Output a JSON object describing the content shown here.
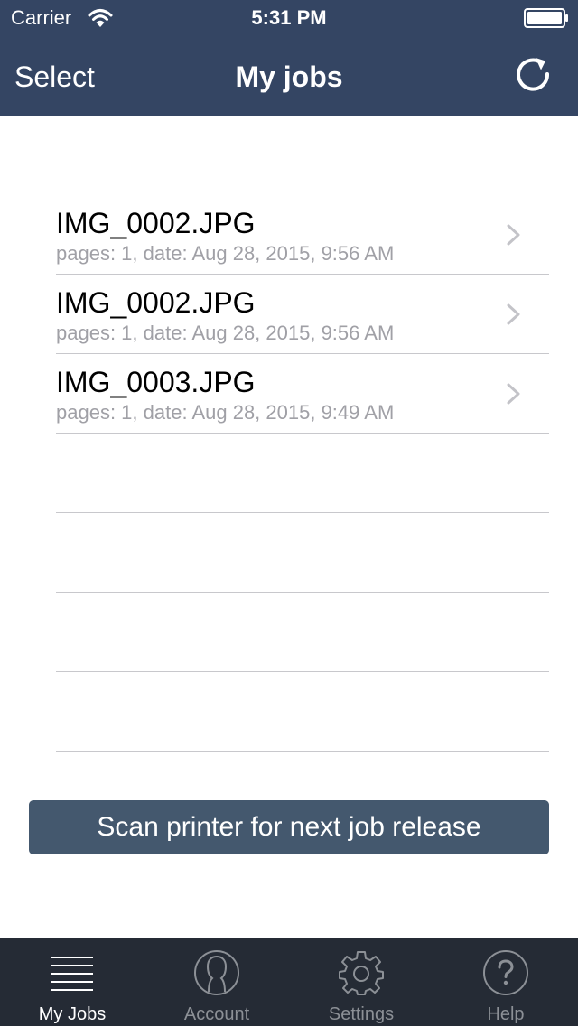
{
  "status_bar": {
    "carrier": "Carrier",
    "time": "5:31 PM"
  },
  "nav": {
    "left_button": "Select",
    "title": "My jobs",
    "right_icon": "refresh-icon"
  },
  "jobs": [
    {
      "name": "IMG_0002.JPG",
      "meta": "pages: 1, date: Aug 28, 2015, 9:56 AM"
    },
    {
      "name": "IMG_0002.JPG",
      "meta": "pages: 1, date: Aug 28, 2015, 9:56 AM"
    },
    {
      "name": "IMG_0003.JPG",
      "meta": "pages: 1, date: Aug 28, 2015, 9:49 AM"
    }
  ],
  "scan_button": {
    "label": "Scan printer for next job release"
  },
  "tab_bar": {
    "active_tab": "My Jobs",
    "tabs": [
      {
        "label": "My Jobs",
        "icon": "list-icon"
      },
      {
        "label": "Account",
        "icon": "user-icon"
      },
      {
        "label": "Settings",
        "icon": "gear-icon"
      },
      {
        "label": "Help",
        "icon": "question-icon"
      }
    ]
  },
  "colors": {
    "header_bg": "#344563",
    "button_bg": "#44586e",
    "tab_bar_bg": "#252b35",
    "secondary_text": "#a0a0a6",
    "separator": "#c8c8cc"
  }
}
